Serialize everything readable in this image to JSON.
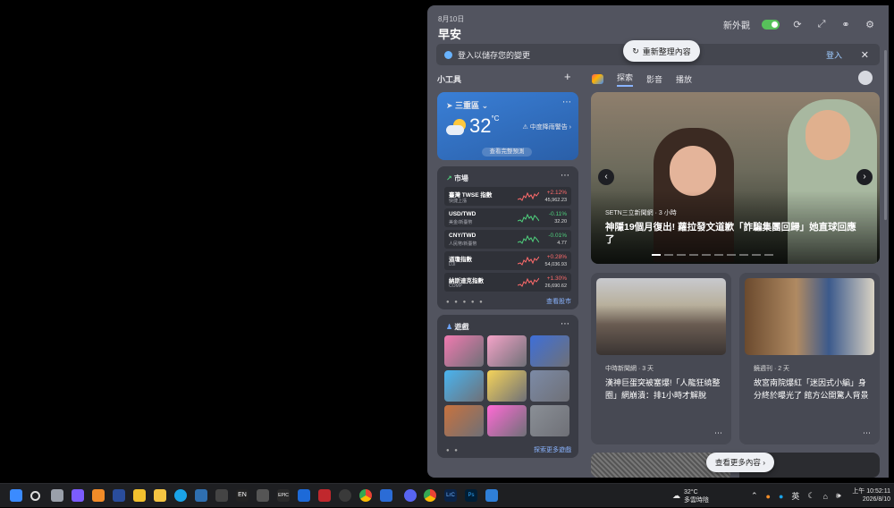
{
  "panel": {
    "date": "8月10日",
    "greeting": "早安",
    "theme_label": "新外觀",
    "signin_text": "登入以儲存您的變更",
    "signin_link": "登入",
    "refresh_label": "重新整理內容"
  },
  "widgets": {
    "title": "小工具",
    "weather": {
      "location": "三重區",
      "temperature": "32",
      "unit": "°C",
      "alert": "中度降雨警告",
      "forecast_link": "查看完整預測"
    },
    "market": {
      "title": "市場",
      "rows": [
        {
          "name": "臺灣 TWSE 指數",
          "sub": "快捷上漲",
          "change": "+2.12%",
          "value": "45,962.23",
          "direction": "up"
        },
        {
          "name": "USD/TWD",
          "sub": "美金/新臺幣",
          "change": "-0.11%",
          "value": "32.20",
          "direction": "down"
        },
        {
          "name": "CNY/TWD",
          "sub": "人民幣/新臺幣",
          "change": "-0.01%",
          "value": "4.77",
          "direction": "down"
        },
        {
          "name": "道瓊指數",
          "sub": "DJI",
          "change": "+0.28%",
          "value": "54,036.93",
          "direction": "up"
        },
        {
          "name": "納斯達克指數",
          "sub": "COMP",
          "change": "+1.30%",
          "value": "26,690.62",
          "direction": "up"
        }
      ],
      "footer_link": "查看股市"
    },
    "games": {
      "title": "遊戲",
      "tile_colors": [
        "#f07ab0",
        "#f4a3c8",
        "#3e6fd8",
        "#49b4f0",
        "#f5d35a",
        "#7c8aa6",
        "#c8723e",
        "#ff6ad5",
        "#8a8f96"
      ],
      "footer_link": "探索更多遊戲"
    }
  },
  "feed": {
    "tabs": [
      "探索",
      "影音",
      "播放"
    ],
    "active_tab": 0,
    "hero": {
      "source": "SETN三立新聞網 · 3 小時",
      "headline": "神隱19個月復出! 蘿拉發文道歉「詐騙集團回歸」她直球回應了"
    },
    "cards": [
      {
        "source": "中時新聞網 · 3 天",
        "headline": "漢神巨蛋突被塞爆!「人龍狂繞整圈」網崩潰：排1小時才解脫"
      },
      {
        "source": "鏡週刊 · 2 天",
        "headline": "故宮南院爆紅「迷因式小編」身分終於曝光了 館方公開驚人背景"
      }
    ],
    "see_more": "查看更多內容"
  },
  "taskbar": {
    "weather_temp": "32°C",
    "weather_desc": "多雲時陰",
    "ime": "英",
    "time": "上午 10:52:11",
    "date": "2026/8/10",
    "icon_labels": [
      "EN",
      "EPIC",
      "LrC",
      "Ps"
    ]
  }
}
